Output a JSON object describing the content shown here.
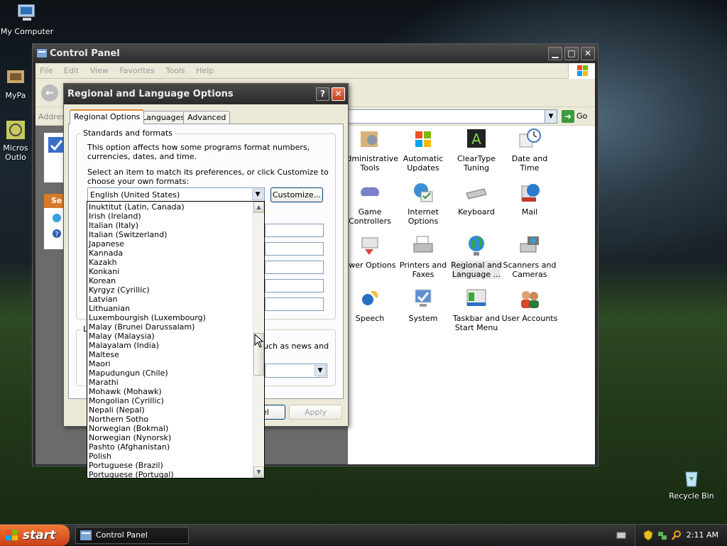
{
  "desktop": {
    "icons": [
      {
        "label": "My Computer"
      },
      {
        "label": "MyPa"
      },
      {
        "label": "Micros Outlo"
      },
      {
        "label": "Recycle Bin"
      }
    ]
  },
  "control_panel": {
    "title": "Control Panel",
    "menu": [
      "File",
      "Edit",
      "View",
      "Favorites",
      "Tools",
      "Help"
    ],
    "address_label": "Addres",
    "go_label": "Go",
    "left_panel_header": "Se",
    "items": [
      {
        "label": "Administrative Tools"
      },
      {
        "label": "Automatic Updates"
      },
      {
        "label": "ClearType Tuning"
      },
      {
        "label": "Date and Time"
      },
      {
        "label": "Game Controllers"
      },
      {
        "label": "Internet Options"
      },
      {
        "label": "Keyboard"
      },
      {
        "label": "Mail"
      },
      {
        "label": "ower Options"
      },
      {
        "label": "Printers and Faxes"
      },
      {
        "label": "Regional and Language ..."
      },
      {
        "label": "Scanners and Cameras"
      },
      {
        "label": "Speech"
      },
      {
        "label": "System"
      },
      {
        "label": "Taskbar and Start Menu"
      },
      {
        "label": "User Accounts"
      }
    ]
  },
  "dialog": {
    "title": "Regional and Language Options",
    "tabs": [
      "Regional Options",
      "Languages",
      "Advanced"
    ],
    "group_title": "Standards and formats",
    "desc": "This option affects how some programs format numbers, currencies, dates, and time.",
    "instruction": "Select an item to match its preferences, or click Customize to choose your own formats:",
    "selected_format": "English (United States)",
    "customize_label": "Customize...",
    "location_partial_label": "L",
    "location_text_partial": "uch as news and",
    "cancel_partial": "el",
    "apply_label": "Apply",
    "dropdown_items": [
      "Inuktitut (Latin, Canada)",
      "Irish (Ireland)",
      "Italian (Italy)",
      "Italian (Switzerland)",
      "Japanese",
      "Kannada",
      "Kazakh",
      "Konkani",
      "Korean",
      "Kyrgyz (Cyrillic)",
      "Latvian",
      "Lithuanian",
      "Luxembourgish (Luxembourg)",
      "Malay (Brunei Darussalam)",
      "Malay (Malaysia)",
      "Malayalam (India)",
      "Maltese",
      "Maori",
      "Mapudungun (Chile)",
      "Marathi",
      "Mohawk (Mohawk)",
      "Mongolian (Cyrillic)",
      "Nepali (Nepal)",
      "Northern Sotho",
      "Norwegian (Bokmal)",
      "Norwegian (Nynorsk)",
      "Pashto (Afghanistan)",
      "Polish",
      "Portuguese (Brazil)",
      "Portuguese (Portugal)"
    ]
  },
  "taskbar": {
    "start_label": "start",
    "task_label": "Control Panel",
    "clock": "2:11 AM"
  },
  "colors": {
    "accent_orange": "#e68b2c",
    "start_green_replaced": "#c8401a",
    "link_blue": "#0a246a"
  }
}
